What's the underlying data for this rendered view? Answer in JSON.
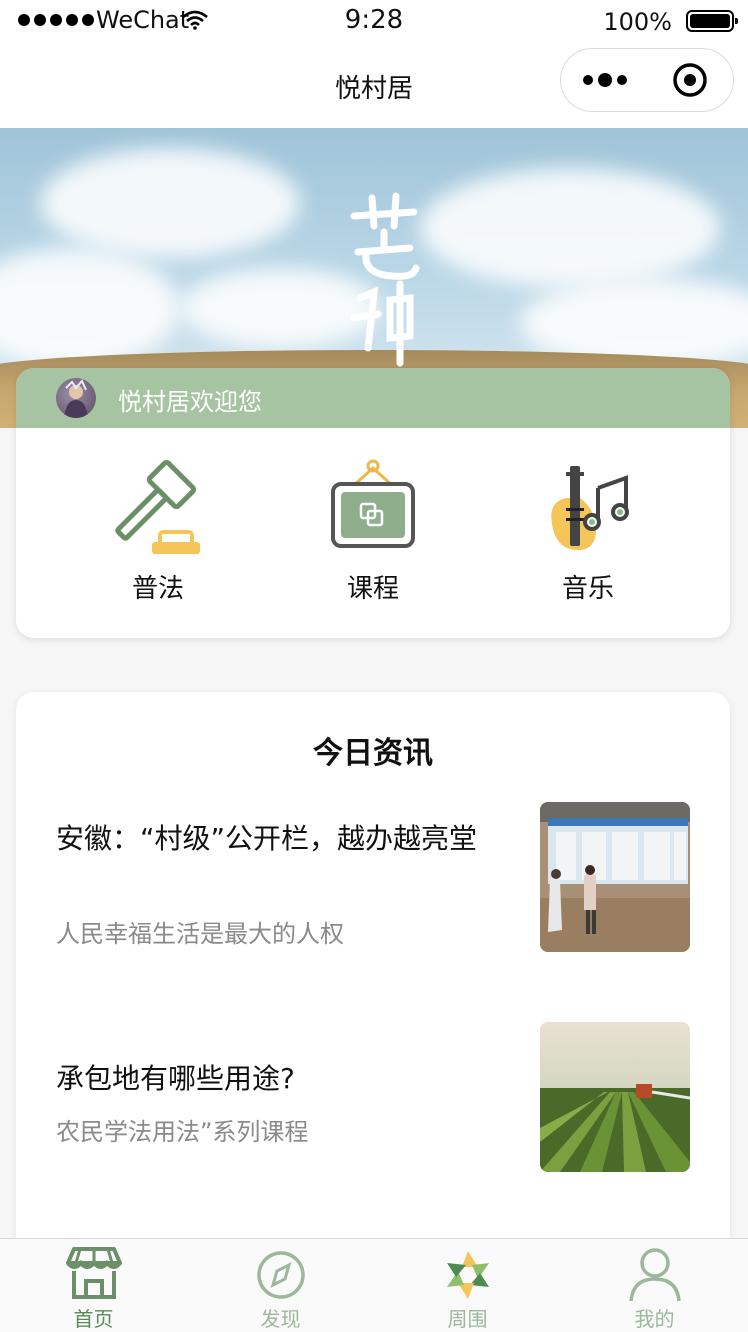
{
  "status_bar": {
    "carrier": "WeChat",
    "time": "9:28",
    "battery": "100%"
  },
  "nav": {
    "title": "悦村居"
  },
  "welcome": {
    "text": "悦村居欢迎您"
  },
  "categories": [
    {
      "label": "普法",
      "icon": "gavel-icon"
    },
    {
      "label": "课程",
      "icon": "course-board-icon"
    },
    {
      "label": "音乐",
      "icon": "music-icon"
    }
  ],
  "news": {
    "heading": "今日资讯",
    "items": [
      {
        "title": "安徽：“村级”公开栏，越办越亮堂",
        "subtitle": "人民幸福生活是最大的人权"
      },
      {
        "title": "承包地有哪些用途?",
        "subtitle": "农民学法用法”系列课程"
      }
    ]
  },
  "tabs": [
    {
      "label": "首页",
      "icon": "home-icon",
      "active": true
    },
    {
      "label": "发现",
      "icon": "compass-icon",
      "active": false
    },
    {
      "label": "周围",
      "icon": "aperture-icon",
      "active": false
    },
    {
      "label": "我的",
      "icon": "user-icon",
      "active": false
    }
  ],
  "colors": {
    "accent": "#a6c4a2",
    "tab_active": "#5a8a56",
    "tab_inactive": "#9db79a"
  }
}
